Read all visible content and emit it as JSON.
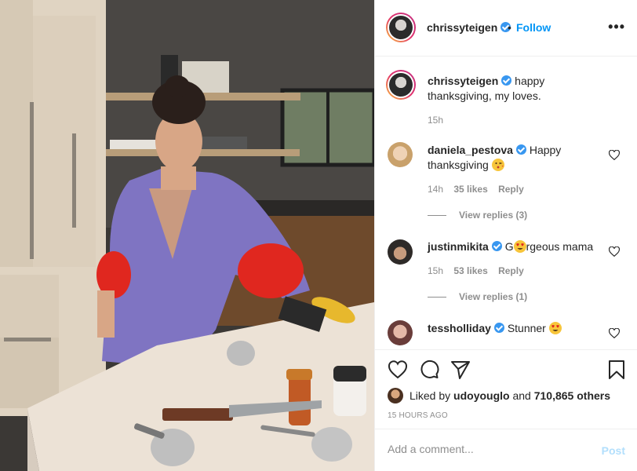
{
  "header": {
    "username": "chrissyteigen",
    "separator": "•",
    "follow_label": "Follow",
    "more_icon": "more-horizontal-icon",
    "more_label": "•••"
  },
  "caption": {
    "username": "chrissyteigen",
    "text": "happy thanksgiving, my loves.",
    "time": "15h"
  },
  "comments": [
    {
      "username": "daniela_pestova",
      "text_before": "Happy thanksgiving",
      "emoji": "kiss-face",
      "time": "14h",
      "likes": "35 likes",
      "reply_label": "Reply",
      "view_replies": "View replies (3)"
    },
    {
      "username": "justinmikita",
      "text_before": "G",
      "emoji": "heart-eyes-face",
      "text_after": "rgeous mama",
      "time": "15h",
      "likes": "53 likes",
      "reply_label": "Reply",
      "view_replies": "View replies (1)"
    },
    {
      "username": "tessholliday",
      "text_before": "Stunner",
      "emoji": "heart-eyes-face"
    }
  ],
  "actions": {
    "like_icon": "heart-icon",
    "comment_icon": "comment-icon",
    "share_icon": "send-icon",
    "save_icon": "bookmark-icon",
    "liked_by_prefix": "Liked by",
    "liked_by_user": "udoyouglo",
    "liked_by_and": "and",
    "liked_by_count": "710,865 others",
    "time_ago": "15 HOURS AGO"
  },
  "add_comment": {
    "placeholder": "Add a comment...",
    "post_label": "Post"
  },
  "colors": {
    "follow_blue": "#0095f6",
    "verified_blue": "#3897f0",
    "muted": "#8e8e8e",
    "post_disabled": "#b2dffc"
  }
}
